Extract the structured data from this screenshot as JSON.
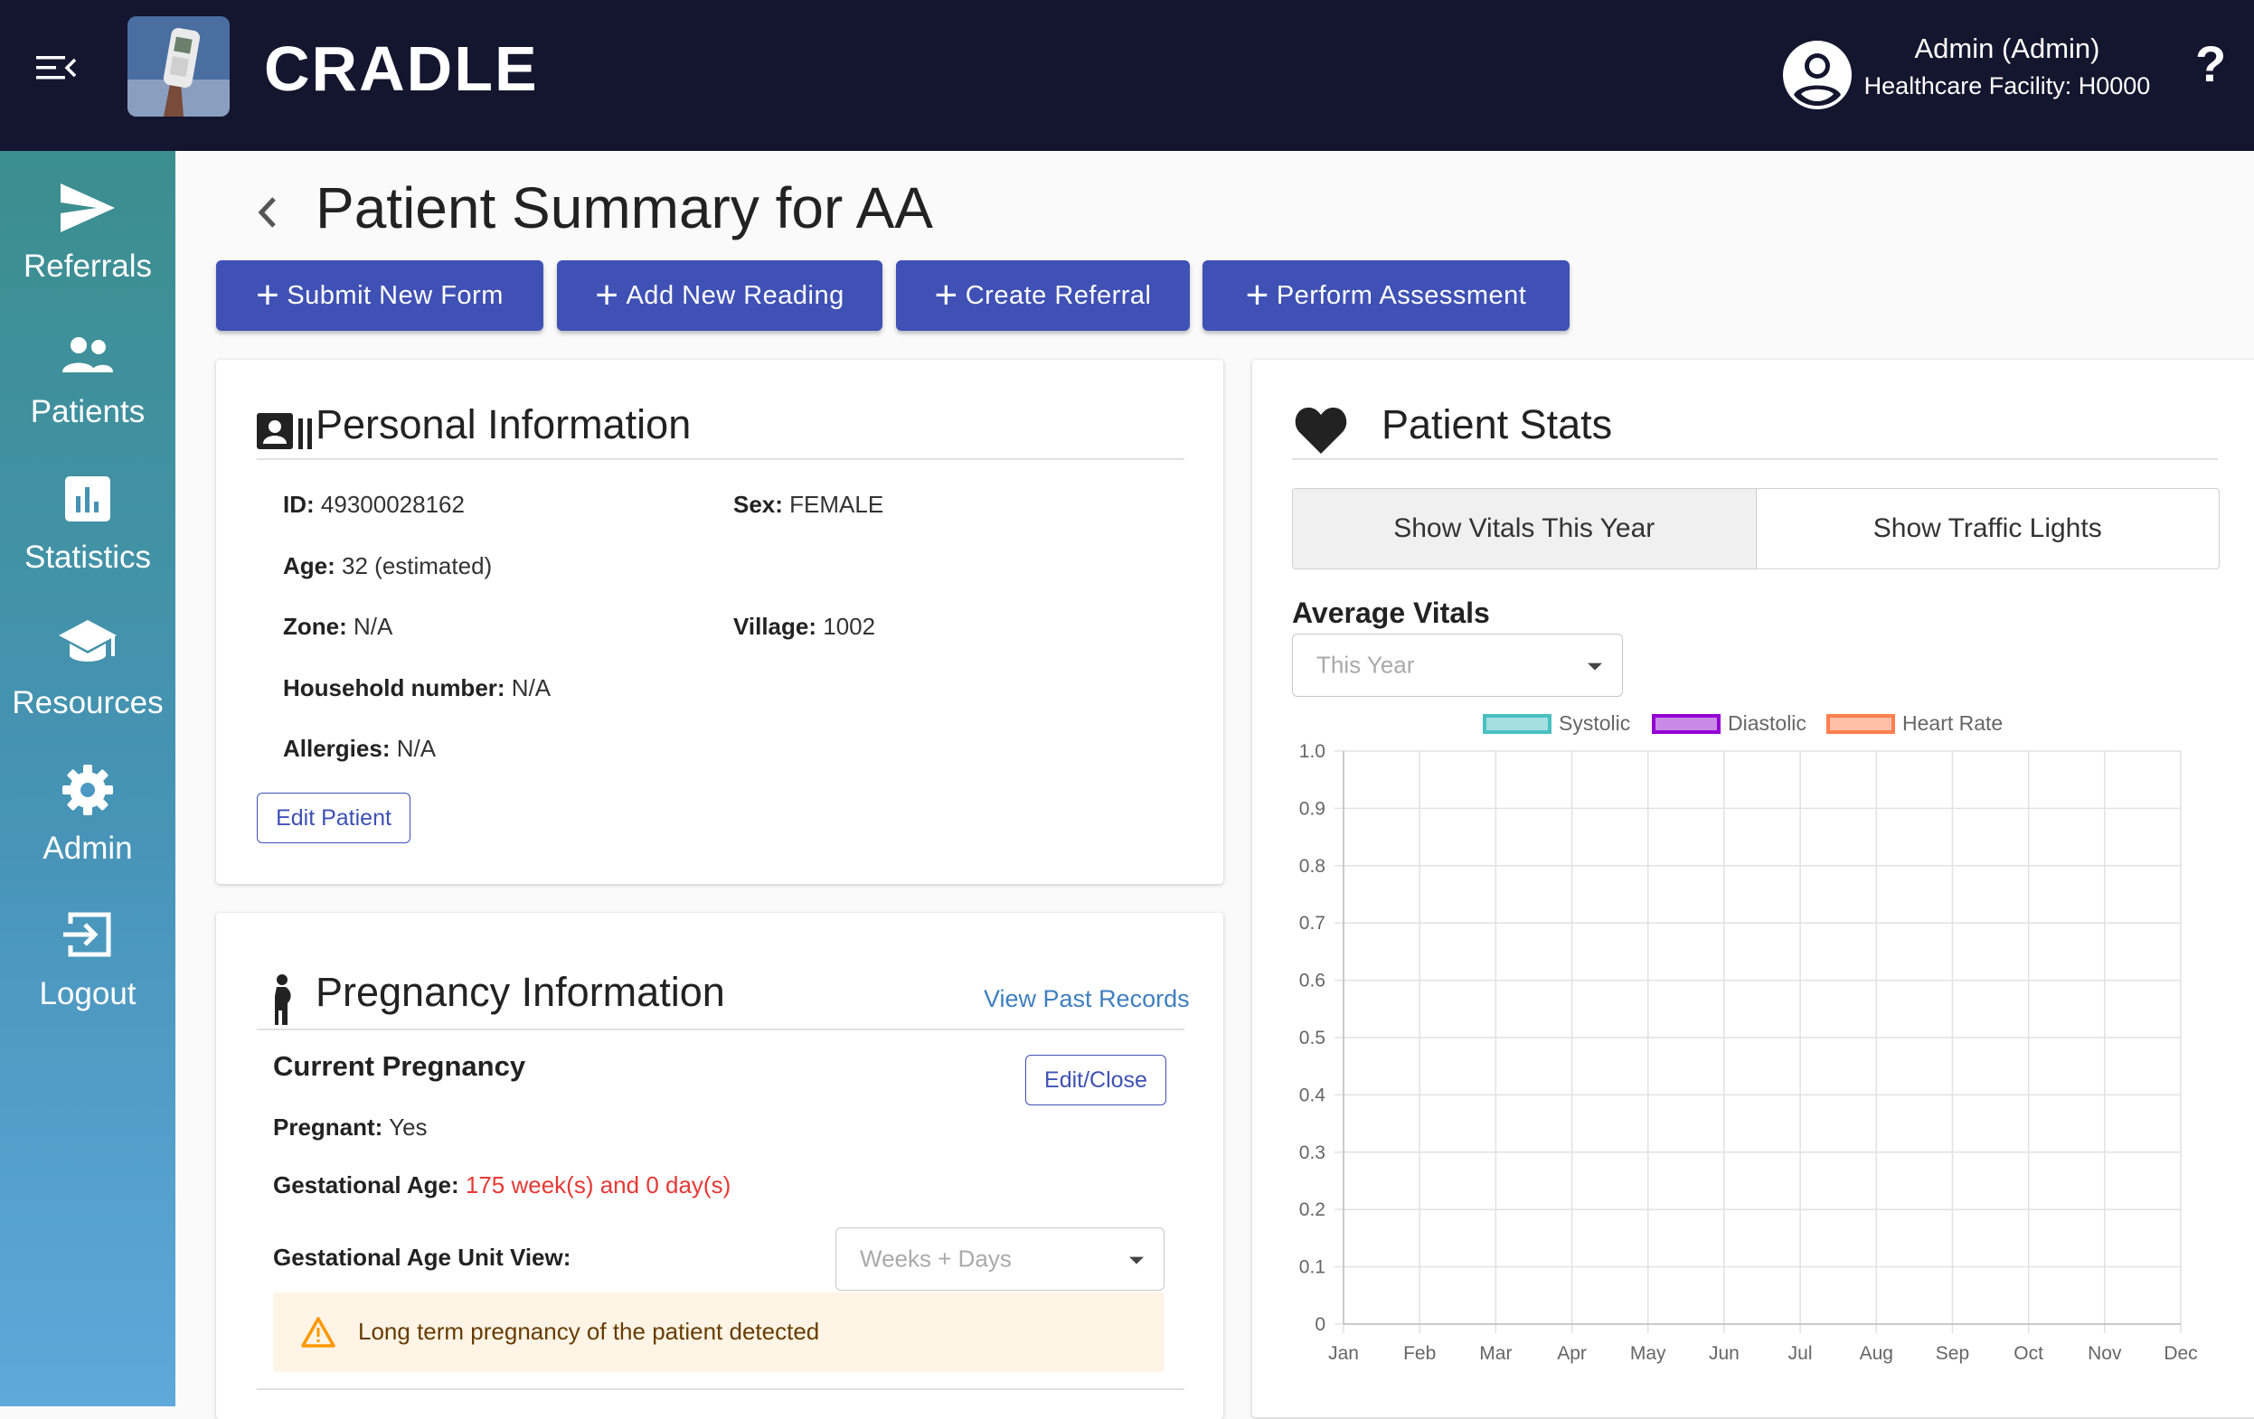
{
  "header": {
    "brand": "CRADLE",
    "user_name": "Admin (Admin)",
    "facility": "Healthcare Facility: H0000",
    "help": "?"
  },
  "sidebar": {
    "items": [
      {
        "label": "Referrals",
        "icon": "send-icon"
      },
      {
        "label": "Patients",
        "icon": "people-icon"
      },
      {
        "label": "Statistics",
        "icon": "bar-chart-icon"
      },
      {
        "label": "Resources",
        "icon": "school-icon"
      },
      {
        "label": "Admin",
        "icon": "gear-icon"
      },
      {
        "label": "Logout",
        "icon": "logout-icon"
      }
    ]
  },
  "page": {
    "title": "Patient Summary for AA",
    "actions": [
      "Submit New Form",
      "Add New Reading",
      "Create Referral",
      "Perform Assessment"
    ]
  },
  "personal": {
    "title": "Personal Information",
    "id_label": "ID:",
    "id_value": "49300028162",
    "sex_label": "Sex:",
    "sex_value": "FEMALE",
    "age_label": "Age:",
    "age_value": "32 (estimated)",
    "zone_label": "Zone:",
    "zone_value": "N/A",
    "village_label": "Village:",
    "village_value": "1002",
    "household_label": "Household number:",
    "household_value": "N/A",
    "allergies_label": "Allergies:",
    "allergies_value": "N/A",
    "edit_button": "Edit Patient"
  },
  "pregnancy": {
    "title": "Pregnancy Information",
    "view_past": "View Past Records",
    "current_title": "Current Pregnancy",
    "edit_close": "Edit/Close",
    "pregnant_label": "Pregnant:",
    "pregnant_value": "Yes",
    "gest_age_label": "Gestational Age:",
    "gest_age_value": "175 week(s) and 0 day(s)",
    "unit_view_label": "Gestational Age Unit View:",
    "unit_view_value": "Weeks + Days",
    "warning": "Long term pregnancy of the patient detected",
    "warning_color": "#ff9800",
    "gest_age_color": "#e53935"
  },
  "stats": {
    "title": "Patient Stats",
    "toggle_vitals": "Show Vitals This Year",
    "toggle_traffic": "Show Traffic Lights",
    "avg_title": "Average Vitals",
    "period_value": "This Year"
  },
  "chart_data": {
    "type": "line",
    "categories": [
      "Jan",
      "Feb",
      "Mar",
      "Apr",
      "May",
      "Jun",
      "Jul",
      "Aug",
      "Sep",
      "Oct",
      "Nov",
      "Dec"
    ],
    "series": [
      {
        "name": "Systolic",
        "values": [],
        "color": "#4bc0c0",
        "fill": "#a5dfdf"
      },
      {
        "name": "Diastolic",
        "values": [],
        "color": "#9400d3",
        "fill": "#c98ae6"
      },
      {
        "name": "Heart Rate",
        "values": [],
        "color": "#ff7f50",
        "fill": "#ffbfa8"
      }
    ],
    "y_ticks": [
      "0",
      "0.1",
      "0.2",
      "0.3",
      "0.4",
      "0.5",
      "0.6",
      "0.7",
      "0.8",
      "0.9",
      "1.0"
    ],
    "ylim": [
      0,
      1
    ],
    "grid": true,
    "legend": "top-center"
  }
}
